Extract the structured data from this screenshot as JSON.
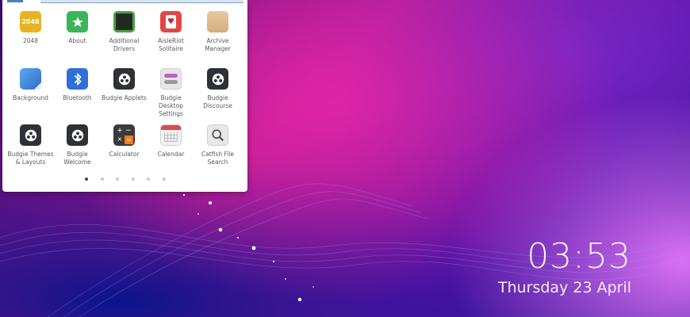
{
  "launcher": {
    "apps": [
      {
        "label": "2048",
        "icon": "game-2048-icon",
        "badge": "2048"
      },
      {
        "label": "About",
        "icon": "star-icon"
      },
      {
        "label": "Additional Drivers",
        "icon": "chip-icon"
      },
      {
        "label": "AisleRiot Solitaire",
        "icon": "playing-card-icon",
        "badge": "♥"
      },
      {
        "label": "Archive Manager",
        "icon": "archive-box-icon"
      },
      {
        "label": "Background",
        "icon": "wallpaper-icon"
      },
      {
        "label": "Bluetooth",
        "icon": "bluetooth-icon"
      },
      {
        "label": "Budgie Applets",
        "icon": "budgie-icon"
      },
      {
        "label": "Budgie Desktop Settings",
        "icon": "toggles-icon"
      },
      {
        "label": "Budgie Discourse",
        "icon": "budgie-icon"
      },
      {
        "label": "Budgie Themes & Layouts",
        "icon": "budgie-icon"
      },
      {
        "label": "Budgie Welcome",
        "icon": "budgie-icon"
      },
      {
        "label": "Calculator",
        "icon": "calculator-icon"
      },
      {
        "label": "Calendar",
        "icon": "calendar-icon"
      },
      {
        "label": "Catfish File Search",
        "icon": "magnifier-icon"
      }
    ],
    "pages": 6,
    "current_page": 1
  },
  "clock": {
    "time": "03:53",
    "date": "Thursday 23 April"
  }
}
